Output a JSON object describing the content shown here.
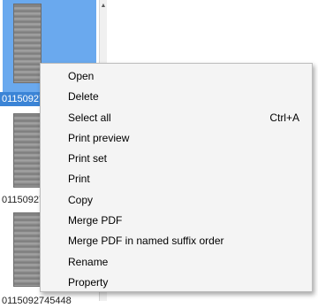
{
  "thumbnails": [
    {
      "caption": "0115092738",
      "selected": true
    },
    {
      "caption": "0115092741",
      "selected": false
    },
    {
      "caption": "0115092745448",
      "selected": false
    }
  ],
  "scrollbar": {
    "up_arrow": "▲"
  },
  "context_menu": {
    "items": [
      {
        "label": "Open",
        "shortcut": ""
      },
      {
        "label": "Delete",
        "shortcut": ""
      },
      {
        "label": "Select all",
        "shortcut": "Ctrl+A"
      },
      {
        "label": "Print preview",
        "shortcut": ""
      },
      {
        "label": "Print set",
        "shortcut": ""
      },
      {
        "label": "Print",
        "shortcut": ""
      },
      {
        "label": "Copy",
        "shortcut": ""
      },
      {
        "label": "Merge PDF",
        "shortcut": ""
      },
      {
        "label": "Merge PDF in named suffix order",
        "shortcut": ""
      },
      {
        "label": "Rename",
        "shortcut": ""
      },
      {
        "label": "Property",
        "shortcut": ""
      }
    ]
  }
}
